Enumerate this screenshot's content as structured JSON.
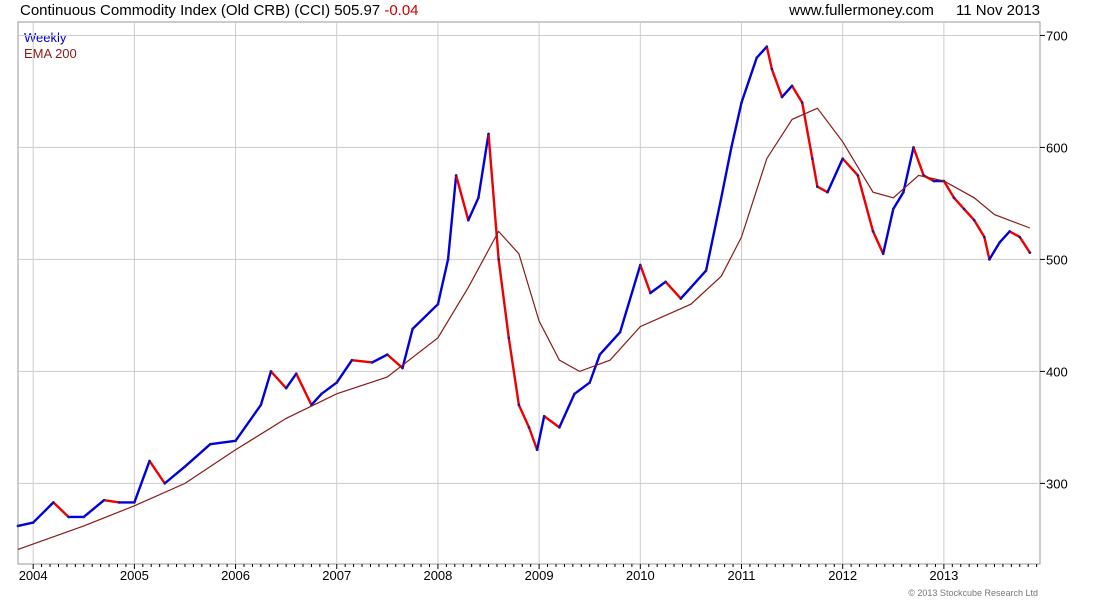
{
  "header": {
    "title": "Continuous Commodity Index (Old CRB) (CCI)",
    "last": "505.97",
    "change": "-0.04",
    "site": "www.fullermoney.com",
    "date": "11 Nov 2013"
  },
  "legend": {
    "series1": "Weekly",
    "series2": "EMA 200"
  },
  "copyright": "© 2013 Stockcube Research Ltd",
  "colors": {
    "up": "#0000dd",
    "down": "#ee0000",
    "ema": "#8b1a1a",
    "grid": "#cccccc"
  },
  "chart_data": {
    "type": "line",
    "x_ticks": [
      "2004",
      "2005",
      "2006",
      "2007",
      "2008",
      "2009",
      "2010",
      "2011",
      "2012",
      "2013"
    ],
    "y_ticks": [
      "300",
      "400",
      "500",
      "600",
      "700"
    ],
    "xlim": [
      2003.85,
      2013.95
    ],
    "ylim": [
      228,
      712
    ],
    "grid": true,
    "legend_position": "top-left",
    "series": [
      {
        "name": "Weekly",
        "x": [
          2003.85,
          2004.0,
          2004.2,
          2004.35,
          2004.5,
          2004.7,
          2004.85,
          2005.0,
          2005.15,
          2005.3,
          2005.5,
          2005.75,
          2006.0,
          2006.25,
          2006.35,
          2006.5,
          2006.6,
          2006.75,
          2006.85,
          2007.0,
          2007.15,
          2007.35,
          2007.5,
          2007.65,
          2007.75,
          2008.0,
          2008.1,
          2008.18,
          2008.3,
          2008.4,
          2008.5,
          2008.6,
          2008.7,
          2008.8,
          2008.9,
          2008.98,
          2009.05,
          2009.2,
          2009.35,
          2009.5,
          2009.6,
          2009.8,
          2010.0,
          2010.1,
          2010.25,
          2010.4,
          2010.5,
          2010.65,
          2010.8,
          2010.9,
          2011.0,
          2011.15,
          2011.25,
          2011.3,
          2011.4,
          2011.5,
          2011.6,
          2011.7,
          2011.75,
          2011.85,
          2012.0,
          2012.15,
          2012.3,
          2012.4,
          2012.5,
          2012.6,
          2012.7,
          2012.8,
          2012.9,
          2013.0,
          2013.1,
          2013.2,
          2013.3,
          2013.4,
          2013.45,
          2013.55,
          2013.65,
          2013.75,
          2013.85
        ],
        "values": [
          262,
          265,
          283,
          270,
          270,
          285,
          283,
          283,
          320,
          300,
          315,
          335,
          338,
          370,
          400,
          385,
          398,
          370,
          380,
          390,
          410,
          408,
          415,
          403,
          438,
          460,
          500,
          575,
          535,
          555,
          612,
          500,
          430,
          370,
          350,
          330,
          360,
          350,
          380,
          390,
          415,
          435,
          495,
          470,
          480,
          465,
          475,
          490,
          555,
          600,
          640,
          680,
          690,
          670,
          645,
          655,
          640,
          590,
          565,
          560,
          590,
          575,
          525,
          505,
          545,
          560,
          600,
          575,
          570,
          570,
          555,
          545,
          535,
          520,
          500,
          515,
          525,
          520,
          506
        ]
      },
      {
        "name": "EMA 200",
        "x": [
          2003.85,
          2004.5,
          2005.0,
          2005.5,
          2006.0,
          2006.5,
          2007.0,
          2007.5,
          2008.0,
          2008.3,
          2008.6,
          2008.8,
          2009.0,
          2009.2,
          2009.4,
          2009.7,
          2010.0,
          2010.5,
          2010.8,
          2011.0,
          2011.25,
          2011.5,
          2011.75,
          2012.0,
          2012.3,
          2012.5,
          2012.75,
          2013.0,
          2013.3,
          2013.5,
          2013.85
        ],
        "values": [
          241,
          262,
          280,
          300,
          330,
          358,
          380,
          395,
          430,
          475,
          525,
          505,
          445,
          410,
          400,
          410,
          440,
          460,
          485,
          520,
          590,
          625,
          635,
          605,
          560,
          555,
          575,
          570,
          555,
          540,
          528
        ]
      }
    ]
  }
}
